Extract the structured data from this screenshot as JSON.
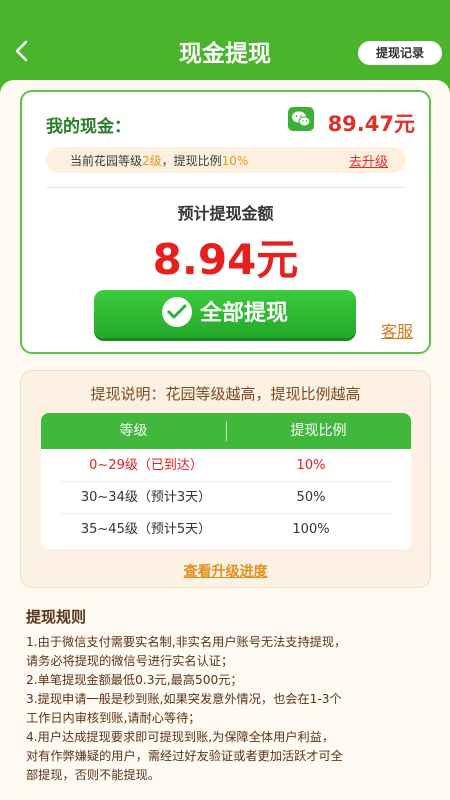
{
  "header": {
    "title": "现金提现",
    "back_icon": "chevron-left-icon",
    "record_label": "提现记录"
  },
  "cash": {
    "label": "我的现金：",
    "amount": "89.47元",
    "icon": "wechat-icon",
    "level_prefix": "当前花园等级",
    "level_value": "2级",
    "ratio_prefix": "，提现比例",
    "ratio_value": "10%",
    "upgrade_label": "去升级",
    "estimate_label": "预计提现金额",
    "estimate_amount": "8.94元",
    "withdraw_label": "全部提现",
    "service_label": "客服"
  },
  "info": {
    "title": "提现说明：花园等级越高，提现比例越高",
    "table": {
      "headers": [
        "等级",
        "提现比例"
      ],
      "rows": [
        {
          "level": "0~29级（已到达）",
          "ratio": "10%",
          "highlight": true
        },
        {
          "level": "30~34级（预计3天）",
          "ratio": "50%",
          "highlight": false
        },
        {
          "level": "35~45级（预计5天）",
          "ratio": "100%",
          "highlight": false
        }
      ]
    },
    "progress_link": "查看升级进度"
  },
  "rules": {
    "title": "提现规则",
    "items": [
      "1.由于微信支付需要实名制,非实名用户账号无法支持提现，",
      "请务必将提现的微信号进行实名认证；",
      "2.单笔提现金额最低0.3元,最高500元；",
      "3.提现申请一般是秒到账,如果突发意外情况，也会在1-3个",
      "工作日内审核到账,请耐心等待；",
      "4.用户达成提现要求即可提现到账,为保障全体用户利益，",
      "对有作弊嫌疑的用户，需经过好友验证或者更加活跃才可全",
      "部提现，否则不能提现。"
    ]
  },
  "colors": {
    "brand_green": "#4ab52c",
    "amount_red": "#e5211d",
    "link_orange": "#e0911e"
  }
}
